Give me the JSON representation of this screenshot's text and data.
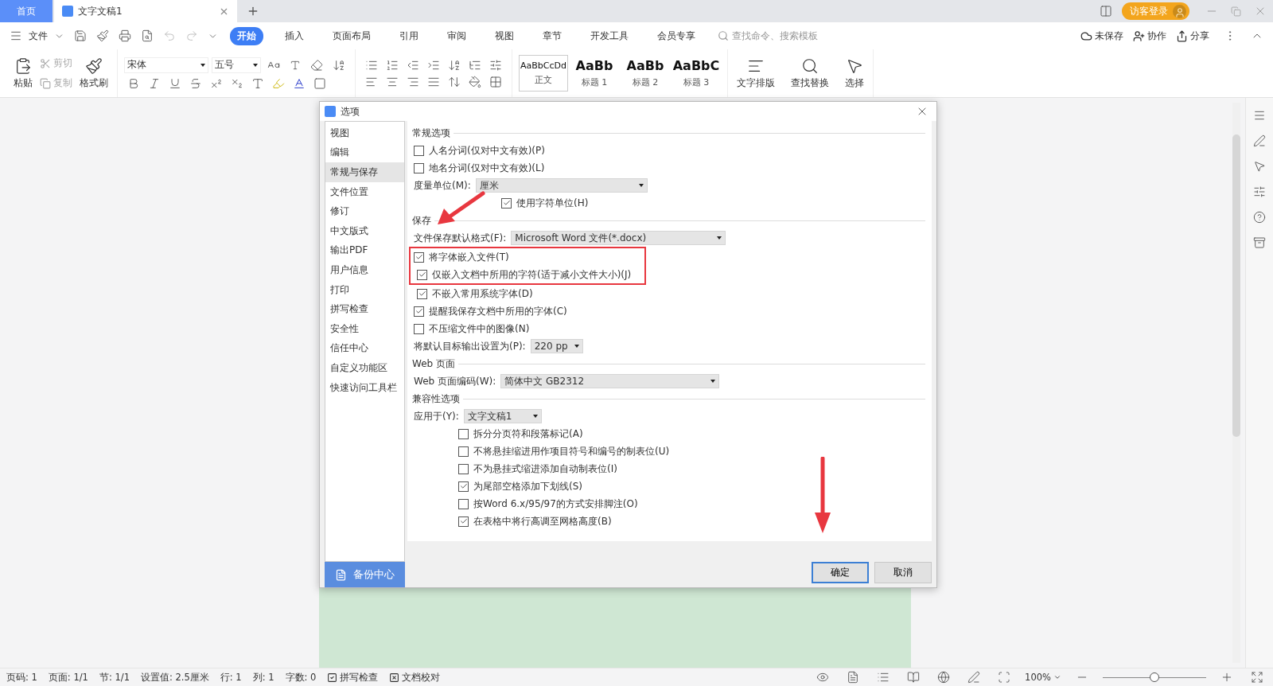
{
  "tabs": [
    {
      "label": "首页",
      "kind": "home",
      "selected": false
    },
    {
      "label": "文字文稿1",
      "kind": "doc",
      "selected": true
    }
  ],
  "account": {
    "label": "访客登录"
  },
  "menu": {
    "file": "文件",
    "tabs": [
      {
        "label": "开始",
        "selected": true
      },
      {
        "label": "插入",
        "selected": false
      },
      {
        "label": "页面布局",
        "selected": false
      },
      {
        "label": "引用",
        "selected": false
      },
      {
        "label": "审阅",
        "selected": false
      },
      {
        "label": "视图",
        "selected": false
      },
      {
        "label": "章节",
        "selected": false
      },
      {
        "label": "开发工具",
        "selected": false
      },
      {
        "label": "会员专享",
        "selected": false
      }
    ],
    "search": {
      "placeholder": "查找命令、搜索模板"
    },
    "actions": [
      "未保存",
      "协作",
      "分享"
    ]
  },
  "ribbon": {
    "clipboard": [
      {
        "label": "剪切",
        "disabled": true
      },
      {
        "label": "复制",
        "disabled": true
      }
    ],
    "paste": "粘贴",
    "format_painter": "格式刷",
    "font": {
      "name": "宋体",
      "size": "五号"
    },
    "styles": [
      {
        "sample": "AaBbCcDd",
        "label": "正文",
        "selected": true
      },
      {
        "sample": "AaBb",
        "label": "标题 1",
        "selected": false
      },
      {
        "sample": "AaBb",
        "label": "标题 2",
        "selected": false
      },
      {
        "sample": "AaBbC",
        "label": "标题 3",
        "selected": false
      }
    ],
    "tools": [
      "文字排版",
      "查找替换",
      "选择"
    ]
  },
  "dialog": {
    "title": "选项",
    "nav": [
      {
        "label": "视图",
        "selected": false
      },
      {
        "label": "编辑",
        "selected": false
      },
      {
        "label": "常规与保存",
        "selected": true
      },
      {
        "label": "文件位置",
        "selected": false
      },
      {
        "label": "修订",
        "selected": false
      },
      {
        "label": "中文版式",
        "selected": false
      },
      {
        "label": "输出PDF",
        "selected": false
      },
      {
        "label": "用户信息",
        "selected": false
      },
      {
        "label": "打印",
        "selected": false
      },
      {
        "label": "拼写检查",
        "selected": false
      },
      {
        "label": "安全性",
        "selected": false
      },
      {
        "label": "信任中心",
        "selected": false
      },
      {
        "label": "自定义功能区",
        "selected": false
      },
      {
        "label": "快速访问工具栏",
        "selected": false
      }
    ],
    "backup": "备份中心",
    "sections": [
      {
        "title": "常规选项",
        "items": [
          {
            "kind": "checkbox",
            "label": "人名分词(仅对中文有效)(P)",
            "checked": false
          },
          {
            "kind": "checkbox",
            "label": "地名分词(仅对中文有效)(L)",
            "checked": false
          },
          {
            "kind": "select",
            "label": "度量单位(M):",
            "value": "厘米",
            "children": [
              {
                "kind": "checkbox",
                "label": "使用字符单位(H)",
                "checked": true
              }
            ]
          }
        ]
      },
      {
        "title": "保存",
        "items": [
          {
            "kind": "select",
            "label": "文件保存默认格式(F):",
            "value": "Microsoft Word 文件(*.docx)"
          },
          {
            "kind": "checkbox",
            "label": "将字体嵌入文件(T)",
            "checked": true,
            "highlighted": true,
            "children": [
              {
                "kind": "checkbox",
                "label": "仅嵌入文档中所用的字符(适于减小文件大小)(J)",
                "checked": true
              },
              {
                "kind": "checkbox",
                "label": "不嵌入常用系统字体(D)",
                "checked": true
              }
            ]
          },
          {
            "kind": "checkbox",
            "label": "提醒我保存文档中所用的字体(C)",
            "checked": true
          },
          {
            "kind": "checkbox",
            "label": "不压缩文件中的图像(N)",
            "checked": false
          },
          {
            "kind": "select",
            "label": "将默认目标输出设置为(P):",
            "value": "220 pp"
          }
        ]
      },
      {
        "title": "Web 页面",
        "items": [
          {
            "kind": "select",
            "label": "Web 页面编码(W):",
            "value": "简体中文 GB2312"
          }
        ]
      },
      {
        "title": "兼容性选项",
        "items": [
          {
            "kind": "select",
            "label": "应用于(Y):",
            "value": "文字文稿1",
            "children": [
              {
                "kind": "checkbox",
                "label": "拆分分页符和段落标记(A)",
                "checked": false
              },
              {
                "kind": "checkbox",
                "label": "不将悬挂缩进用作项目符号和编号的制表位(U)",
                "checked": false
              },
              {
                "kind": "checkbox",
                "label": "不为悬挂式缩进添加自动制表位(I)",
                "checked": false
              },
              {
                "kind": "checkbox",
                "label": "为尾部空格添加下划线(S)",
                "checked": true
              },
              {
                "kind": "checkbox",
                "label": "按Word 6.x/95/97的方式安排脚注(O)",
                "checked": false
              },
              {
                "kind": "checkbox",
                "label": "在表格中将行高调至网格高度(B)",
                "checked": true
              }
            ]
          }
        ]
      }
    ],
    "buttons": [
      {
        "label": "确定",
        "selected": true
      },
      {
        "label": "取消",
        "selected": false
      }
    ]
  },
  "status_bar": {
    "items": [
      "页码: 1",
      "页面: 1/1",
      "节: 1/1",
      "设置值: 2.5厘米",
      "行: 1",
      "列: 1",
      "字数: 0"
    ],
    "spell": "拼写检查",
    "proof": "文档校对",
    "zoom": "100%",
    "zoom_level": {
      "level": 0.5
    }
  }
}
